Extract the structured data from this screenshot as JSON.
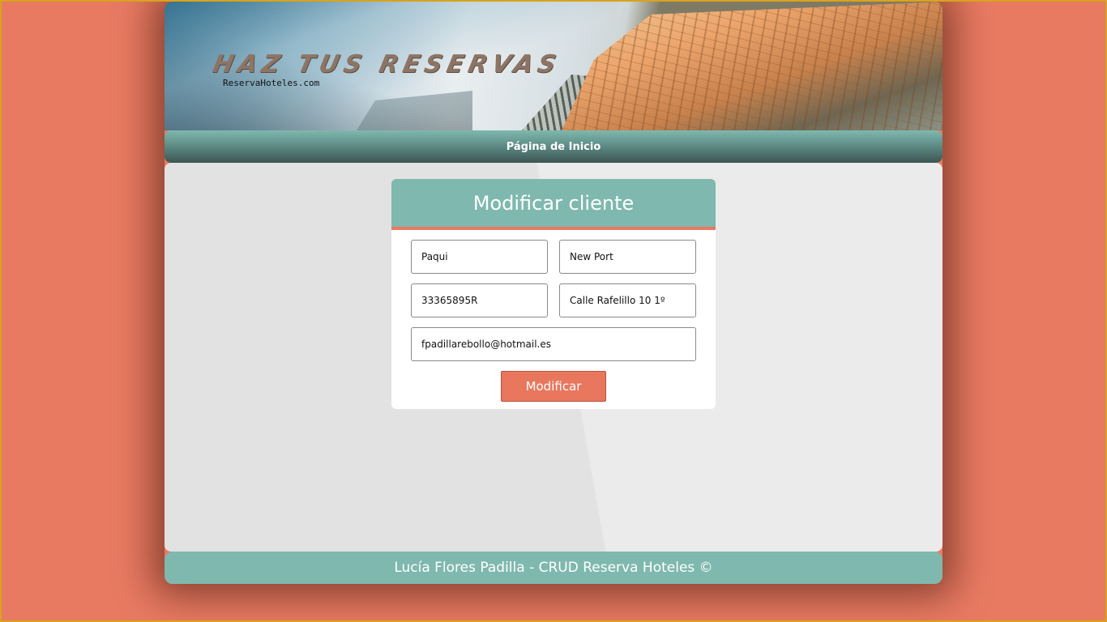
{
  "banner": {
    "title": "HAZ TUS RESERVAS",
    "subtitle": "ReservaHoteles.com"
  },
  "nav": {
    "home_label": "Página de Inicio"
  },
  "form": {
    "title": "Modificar cliente",
    "fields": {
      "nombre": "Paqui",
      "ciudad": "New Port",
      "dni": "33365895R",
      "direccion": "Calle Rafelillo 10 1º",
      "email": "fpadillarebollo@hotmail.es"
    },
    "submit_label": "Modificar"
  },
  "footer": {
    "text": "Lucía Flores Padilla - CRUD Reserva Hoteles ©"
  },
  "colors": {
    "background": "#e87a62",
    "accent_teal": "#7fb8ae",
    "button": "#e8775e",
    "frame_border": "#d9a21e"
  }
}
